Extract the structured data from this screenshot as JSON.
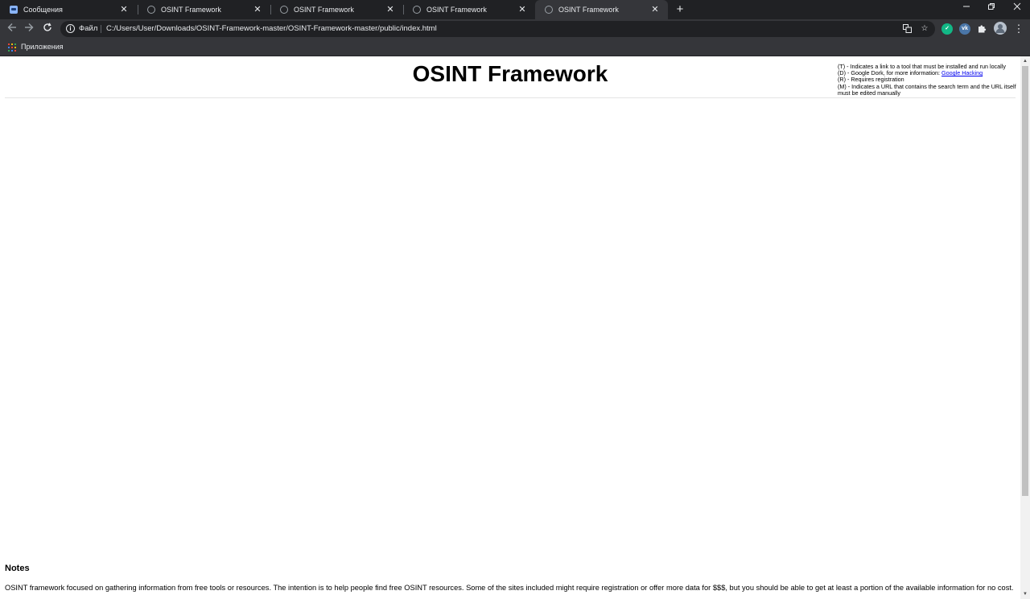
{
  "browser": {
    "tabs": [
      {
        "title": "Сообщения",
        "icon": "message-icon",
        "active": false
      },
      {
        "title": "OSINT Framework",
        "icon": "globe-icon",
        "active": false
      },
      {
        "title": "OSINT Framework",
        "icon": "globe-icon",
        "active": false
      },
      {
        "title": "OSINT Framework",
        "icon": "globe-icon",
        "active": false
      },
      {
        "title": "OSINT Framework",
        "icon": "globe-icon",
        "active": true
      }
    ],
    "address_bar": {
      "scheme_label": "Файл",
      "url": "C:/Users/User/Downloads/OSINT-Framework-master/OSINT-Framework-master/public/index.html"
    },
    "extensions": [
      {
        "name": "shield-extension",
        "label": "",
        "color": "#12b886"
      },
      {
        "name": "vk-extension",
        "label": "vk",
        "color": "#4a76a8"
      },
      {
        "name": "puzzle-extension",
        "label": "",
        "color": ""
      }
    ],
    "bookmarks_bar": {
      "apps_label": "Приложения"
    },
    "colors": {
      "tabstrip": "#202124",
      "toolbar": "#35363a",
      "text": "#e8eaed"
    }
  },
  "page": {
    "title": "OSINT Framework",
    "legend": {
      "line_t": "(T) - Indicates a link to a tool that must be installed and run locally",
      "line_d_prefix": "(D) - Google Dork, for more information: ",
      "line_d_link": "Google Hacking",
      "line_r": "(R) - Requires registration",
      "line_m": "(M) - Indicates a URL that contains the search term and the URL itself must be edited manually"
    },
    "notes": {
      "heading": "Notes",
      "body": "OSINT framework focused on gathering information from free tools or resources. The intention is to help people find free OSINT resources. Some of the sites included might require registration or offer more data for $$$, but you should be able to get at least a portion of the available information for no cost."
    }
  }
}
